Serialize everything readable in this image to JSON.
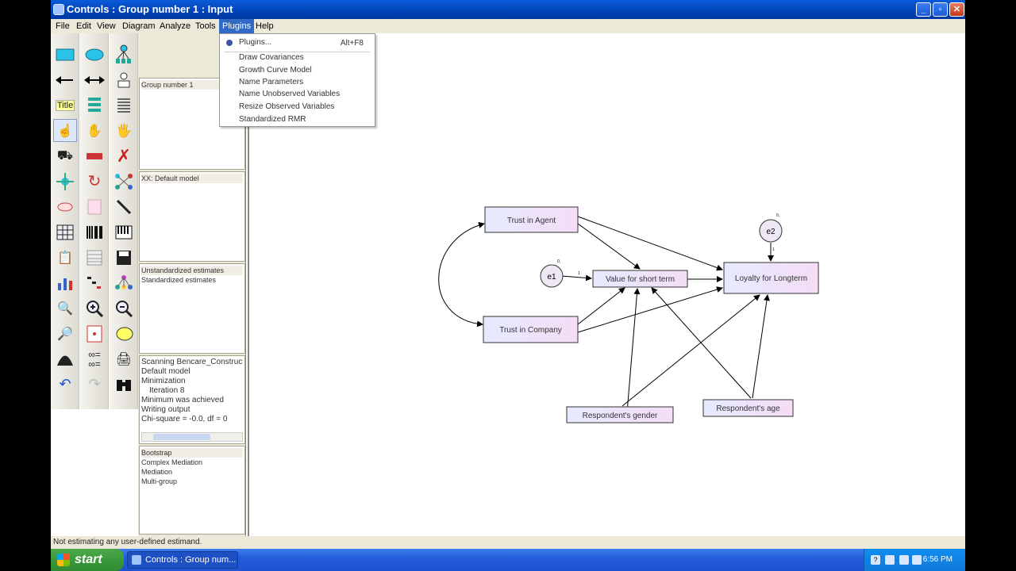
{
  "window": {
    "title": "Controls : Group number 1 : Input",
    "buttons": {
      "minimize": "_",
      "maximize": "▫",
      "close": "✕"
    }
  },
  "menubar": [
    "File",
    "Edit",
    "View",
    "Diagram",
    "Analyze",
    "Tools",
    "Plugins",
    "Help"
  ],
  "plugins_menu": {
    "top_item": "Plugins...",
    "top_shortcut": "Alt+F8",
    "items": [
      "Draw Covariances",
      "Growth Curve Model",
      "Name Parameters",
      "Name Unobserved Variables",
      "Resize Observed Variables",
      "Standardized RMR"
    ]
  },
  "toolbox_icons": {
    "col1": [
      "rectangle-icon",
      "arrow-left-icon",
      "title-icon",
      "hand-select-icon",
      "truck-icon",
      "move-icon",
      "shape-icon",
      "grid-icon",
      "clipboard-icon",
      "chart-icon",
      "zoom-icon",
      "zoom-page-icon",
      "histogram-icon",
      "undo-icon"
    ],
    "col2": [
      "ellipse-icon",
      "double-arrow-icon",
      "list-icon",
      "hand-all-icon",
      "select-row-icon",
      "rotate-icon",
      "empty-icon",
      "barcode-icon",
      "table-icon",
      "tree-icon",
      "zoom-in-icon",
      "fit-page-icon",
      "double-glasses-icon",
      "redo-icon"
    ],
    "col3": [
      "indicator-icon",
      "person-icon",
      "list-lines-icon",
      "hand-deselect-icon",
      "delete-icon",
      "network-icon",
      "magic-wand-icon",
      "piano-icon",
      "save-icon",
      "tree-colored-icon",
      "zoom-out-icon",
      "abc-icon",
      "printer-icon",
      "binoculars-icon"
    ],
    "title_label": "Title"
  },
  "panels": {
    "groups": [
      "Group number 1"
    ],
    "models": [
      "XX: Default model"
    ],
    "estimates": [
      "Unstandardized estimates",
      "Standardized estimates"
    ],
    "log": [
      "Scanning Bencare_Constructs",
      "Default model",
      "Minimization",
      "  Iteration 8",
      "Minimum was achieved",
      "Writing output",
      "Chi-square = -0.0, df = 0"
    ],
    "plugins": [
      "Bootstrap",
      "Complex Mediation",
      "Mediation",
      "Multi-group"
    ]
  },
  "diagram": {
    "boxes": {
      "trust_agent": "Trust in Agent",
      "trust_company": "Trust in Company",
      "value_short": "Value for short term",
      "loyalty_long": "Loyalty for Longterm",
      "gender": "Respondent's gender",
      "age": "Respondent's age"
    },
    "errors": {
      "e1": "e1",
      "e2": "e2"
    },
    "tiny_labels": {
      "e1_label": "0,",
      "e2_label": "0,",
      "path_one": "1"
    }
  },
  "statusbar": "Not estimating any user-defined estimand.",
  "taskbar": {
    "start": "start",
    "task": "Controls : Group num...",
    "clock": "6:56 PM",
    "tray_help": "?"
  }
}
